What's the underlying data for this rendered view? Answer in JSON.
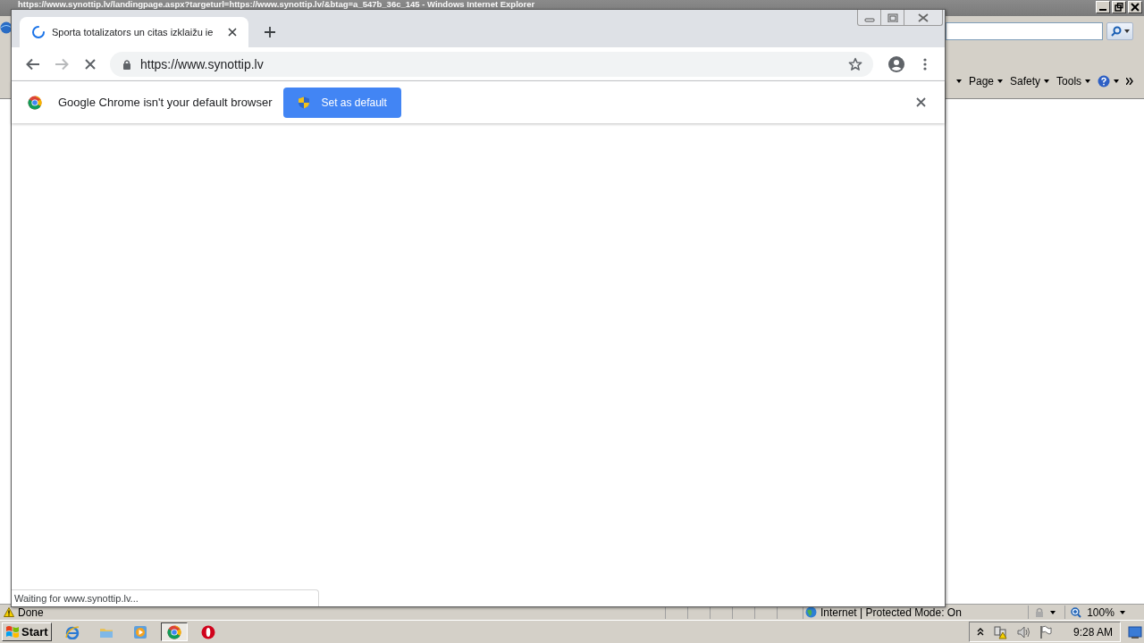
{
  "ie_window": {
    "title": "https://www.synottip.lv/landingpage.aspx?targeturl=https://www.synottip.lv/&btag=a_547b_36c_145 - Windows Internet Explorer",
    "command_bar": [
      "Page",
      "Safety",
      "Tools"
    ],
    "status": "Done",
    "zone": "Internet | Protected Mode: On",
    "zoom": "100%"
  },
  "chrome_window": {
    "tab": {
      "title": "Sporta totalizators un citas izklaižu ie",
      "loading": true
    },
    "address": "https://www.synottip.lv",
    "infobar": {
      "message": "Google Chrome isn't your default browser",
      "button": "Set as default"
    },
    "status_bubble": "Waiting for www.synottip.lv..."
  },
  "taskbar": {
    "start": "Start",
    "clock": "9:28 AM",
    "items": [
      {
        "kind": "ie",
        "selected": false
      },
      {
        "kind": "folder",
        "selected": false
      },
      {
        "kind": "media",
        "selected": false
      },
      {
        "kind": "chrome",
        "selected": true
      },
      {
        "kind": "opera",
        "selected": false
      }
    ]
  }
}
